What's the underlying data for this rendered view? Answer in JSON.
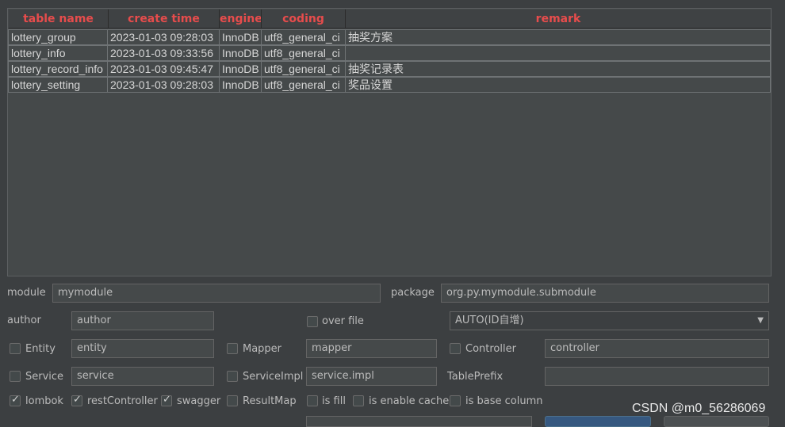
{
  "table": {
    "headers": [
      "table name",
      "create time",
      "engine",
      "coding",
      "remark"
    ],
    "rows": [
      [
        "lottery_group",
        "2023-01-03 09:28:03",
        "InnoDB",
        "utf8_general_ci",
        "抽奖方案"
      ],
      [
        "lottery_info",
        "2023-01-03 09:33:56",
        "InnoDB",
        "utf8_general_ci",
        ""
      ],
      [
        "lottery_record_info",
        "2023-01-03 09:45:47",
        "InnoDB",
        "utf8_general_ci",
        "抽奖记录表"
      ],
      [
        "lottery_setting",
        "2023-01-03 09:28:03",
        "InnoDB",
        "utf8_general_ci",
        "奖品设置"
      ]
    ]
  },
  "form": {
    "module_label": "module",
    "module_value": "mymodule",
    "package_label": "package",
    "package_value": "org.py.mymodule.submodule",
    "author_label": "author",
    "author_value": "author",
    "over_file_label": "over file",
    "id_type_value": "AUTO(ID自增)",
    "entity_label": "Entity",
    "entity_value": "entity",
    "mapper_label": "Mapper",
    "mapper_value": "mapper",
    "controller_label": "Controller",
    "controller_value": "controller",
    "service_label": "Service",
    "service_value": "service",
    "serviceimpl_label": "ServiceImpl",
    "serviceimpl_value": "service.impl",
    "tableprefix_label": "TablePrefix",
    "tableprefix_value": "",
    "lombok_label": "lombok",
    "restcontroller_label": "restController",
    "swagger_label": "swagger",
    "resultmap_label": "ResultMap",
    "isfill_label": "is fill",
    "enablecache_label": "is enable cache",
    "basecolumn_label": "is base column"
  },
  "watermark": "CSDN @m0_56286069",
  "colors": {
    "header_text": "#e74c4c",
    "background": "#3c3f41",
    "primary_button": "#365880"
  }
}
